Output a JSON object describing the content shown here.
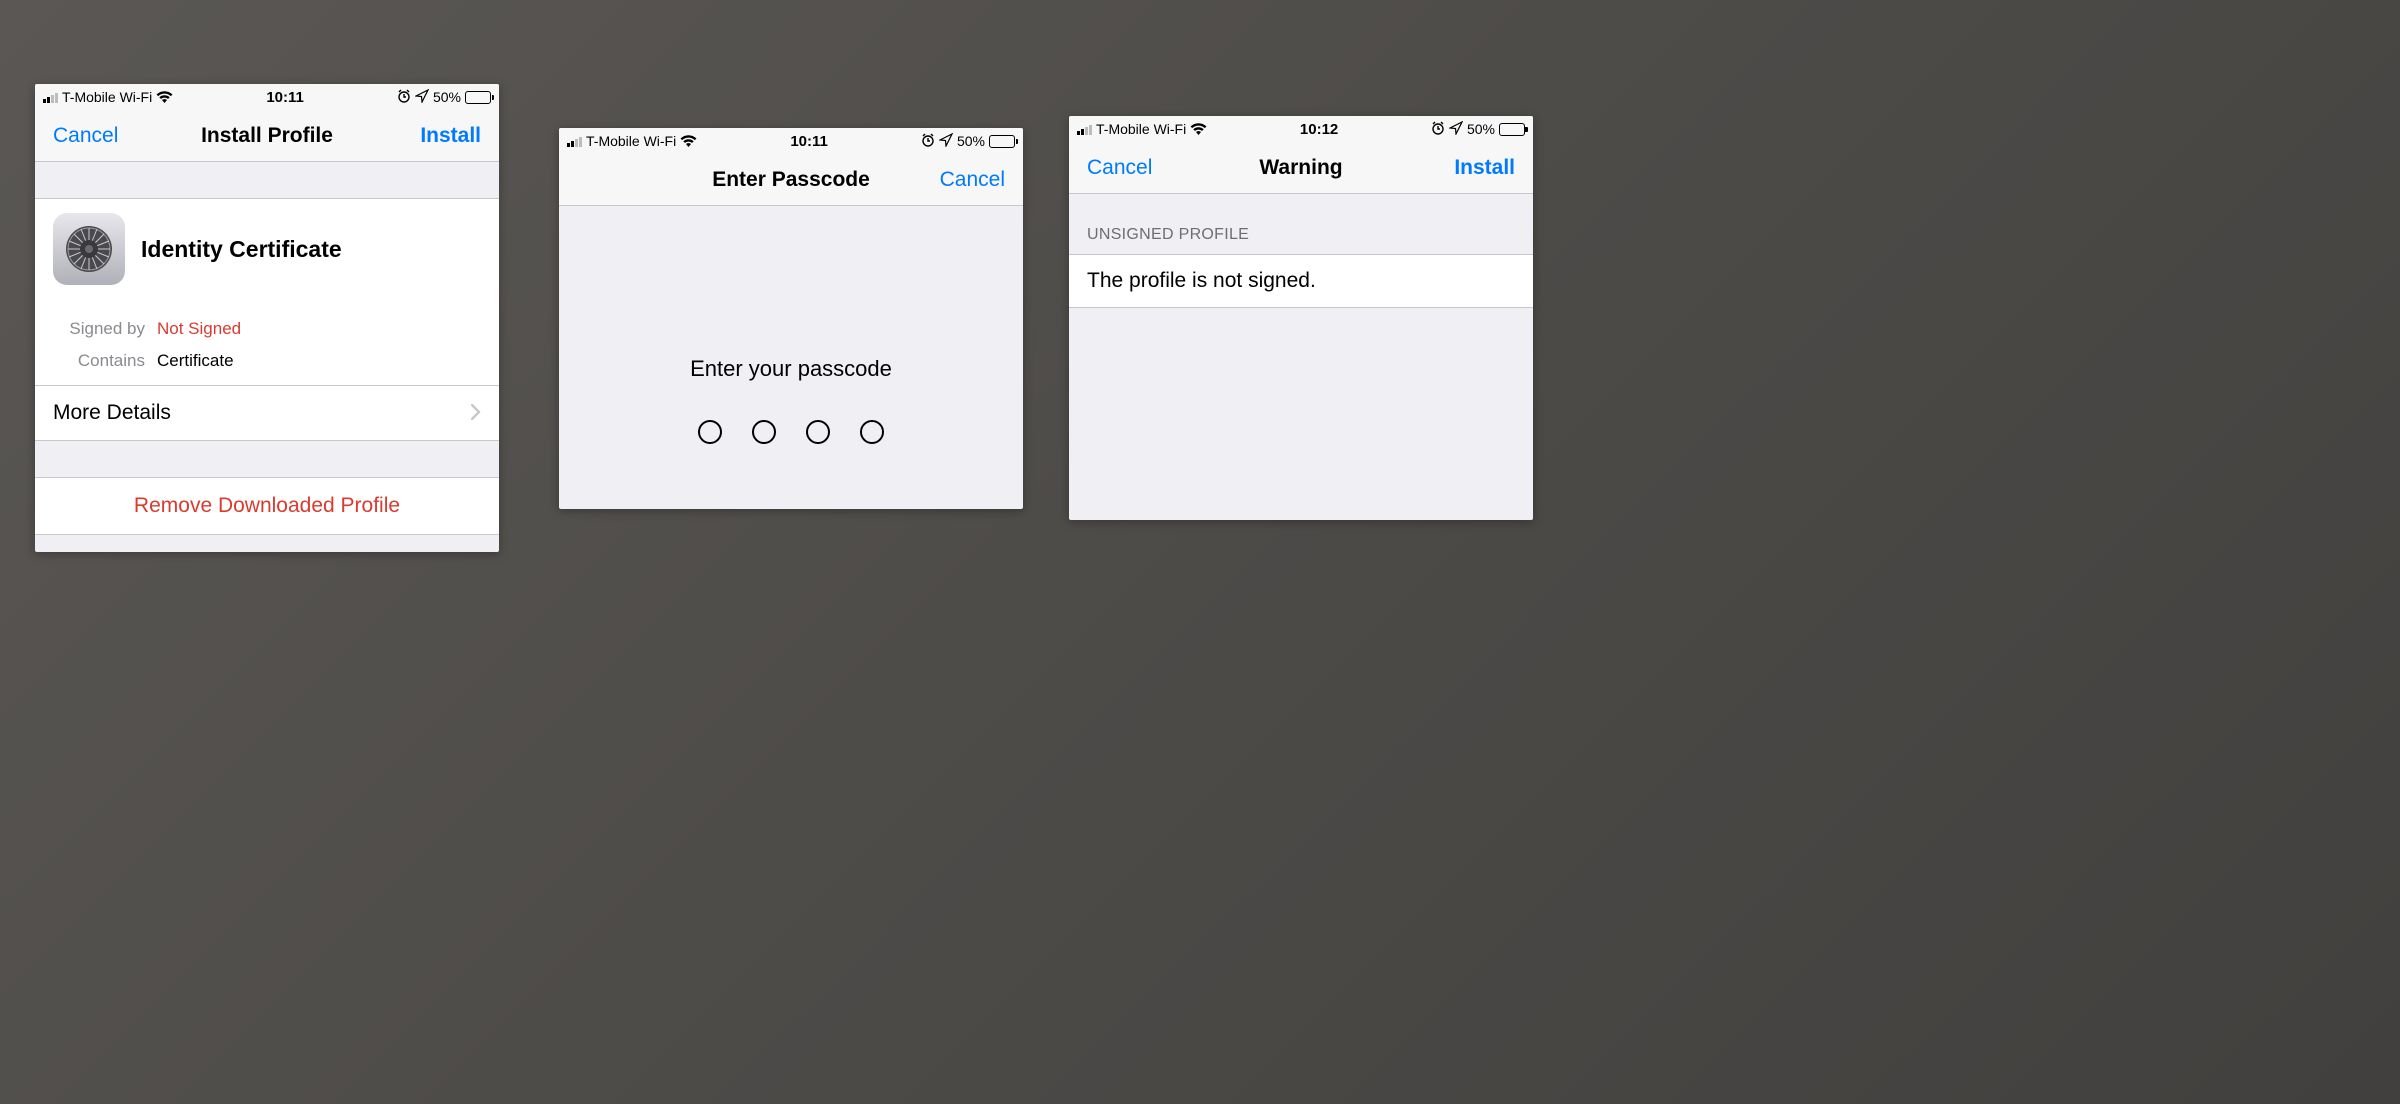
{
  "status": {
    "carrier": "T-Mobile Wi-Fi",
    "battery_text": "50%",
    "time_a": "10:11",
    "time_b": "10:11",
    "time_c": "10:12"
  },
  "screen1": {
    "cancel": "Cancel",
    "title": "Install Profile",
    "install": "Install",
    "profile_name": "Identity Certificate",
    "signed_by_label": "Signed by",
    "signed_by_value": "Not Signed",
    "contains_label": "Contains",
    "contains_value": "Certificate",
    "more_details": "More Details",
    "remove": "Remove Downloaded Profile"
  },
  "screen2": {
    "title": "Enter Passcode",
    "cancel": "Cancel",
    "prompt": "Enter your passcode"
  },
  "screen3": {
    "cancel": "Cancel",
    "title": "Warning",
    "install": "Install",
    "section": "UNSIGNED PROFILE",
    "message": "The profile is not signed."
  }
}
